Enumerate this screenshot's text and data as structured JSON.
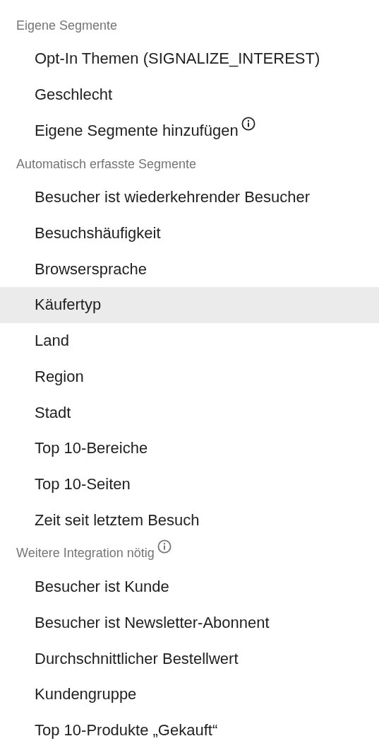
{
  "sections": [
    {
      "title": "Eigene Segmente",
      "info": false,
      "items": [
        {
          "label": "Opt-In Themen (SIGNALIZE_INTEREST)",
          "info": false,
          "selected": false
        },
        {
          "label": "Geschlecht",
          "info": false,
          "selected": false
        },
        {
          "label": "Eigene Segmente hinzufügen",
          "info": true,
          "selected": false
        }
      ]
    },
    {
      "title": "Automatisch erfasste Segmente",
      "info": false,
      "items": [
        {
          "label": "Besucher ist wiederkehrender Besucher",
          "info": false,
          "selected": false
        },
        {
          "label": "Besuchshäufigkeit",
          "info": false,
          "selected": false
        },
        {
          "label": "Browsersprache",
          "info": false,
          "selected": false
        },
        {
          "label": "Käufertyp",
          "info": false,
          "selected": true
        },
        {
          "label": "Land",
          "info": false,
          "selected": false
        },
        {
          "label": "Region",
          "info": false,
          "selected": false
        },
        {
          "label": "Stadt",
          "info": false,
          "selected": false
        },
        {
          "label": "Top 10-Bereiche",
          "info": false,
          "selected": false
        },
        {
          "label": "Top 10-Seiten",
          "info": false,
          "selected": false
        },
        {
          "label": "Zeit seit letztem Besuch",
          "info": false,
          "selected": false
        }
      ]
    },
    {
      "title": "Weitere Integration nötig",
      "info": true,
      "items": [
        {
          "label": "Besucher ist Kunde",
          "info": false,
          "selected": false
        },
        {
          "label": "Besucher ist Newsletter-Abonnent",
          "info": false,
          "selected": false
        },
        {
          "label": "Durchschnittlicher Bestellwert",
          "info": false,
          "selected": false
        },
        {
          "label": "Kundengruppe",
          "info": false,
          "selected": false
        },
        {
          "label": "Top 10-Produkte „Gekauft“",
          "info": false,
          "selected": false
        }
      ]
    }
  ]
}
